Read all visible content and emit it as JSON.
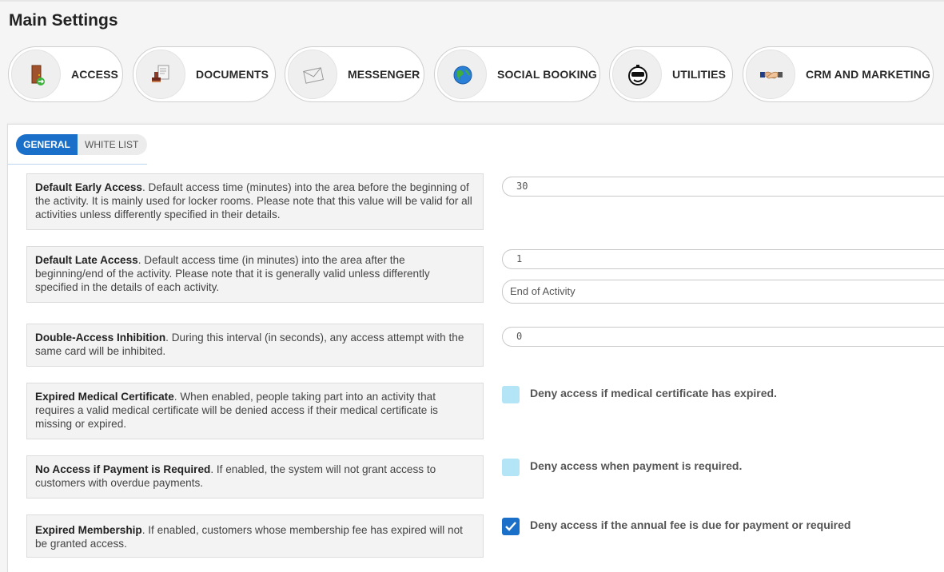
{
  "page": {
    "title": "Main Settings"
  },
  "modules": [
    {
      "label": "ACCESS",
      "icon": "door-exit-icon"
    },
    {
      "label": "DOCUMENTS",
      "icon": "stamp-document-icon"
    },
    {
      "label": "MESSENGER",
      "icon": "envelope-icon"
    },
    {
      "label": "SOCIAL BOOKING",
      "icon": "globe-icon"
    },
    {
      "label": "UTILITIES",
      "icon": "robot-head-icon"
    },
    {
      "label": "CRM AND MARKETING",
      "icon": "handshake-icon"
    }
  ],
  "tabs": {
    "general": "GENERAL",
    "white_list": "WHITE LIST"
  },
  "settings": {
    "early": {
      "title": "Default Early Access",
      "desc": ". Default access time (minutes) into the area before the beginning of the activity. It is mainly used for locker rooms. Please note that this value will be valid for all activities unless differently specified in their details.",
      "value": "30"
    },
    "late": {
      "title": "Default Late Access",
      "desc": ". Default access time (in minutes) into the area after the beginning/end of the activity. Please note that it is generally valid unless differently specified in the details of each activity.",
      "value": "1",
      "mode": "End of Activity"
    },
    "double": {
      "title": "Double-Access Inhibition",
      "desc": ". During this interval (in seconds), any access attempt with the same card will be inhibited.",
      "value": "0"
    },
    "medical": {
      "title": "Expired Medical Certificate",
      "desc": ". When enabled, people taking part into an activity that requires a valid medical certificate will be denied access if their medical certificate is missing or expired.",
      "check_label": "Deny access if medical certificate has expired.",
      "checked": false
    },
    "payment": {
      "title": "No Access if Payment is Required",
      "desc": ". If enabled, the system will not grant access to customers with overdue payments.",
      "check_label": "Deny access when payment is required.",
      "checked": false
    },
    "membership": {
      "title": "Expired Membership",
      "desc": ". If enabled, customers whose membership fee has expired will not be granted access.",
      "check_label": "Deny access if the annual fee is due for payment or required",
      "checked": true
    }
  },
  "colors": {
    "accent": "#1a6fc9",
    "checkbox_off": "#b3e5f7",
    "row_bg": "#f3f3f3"
  }
}
